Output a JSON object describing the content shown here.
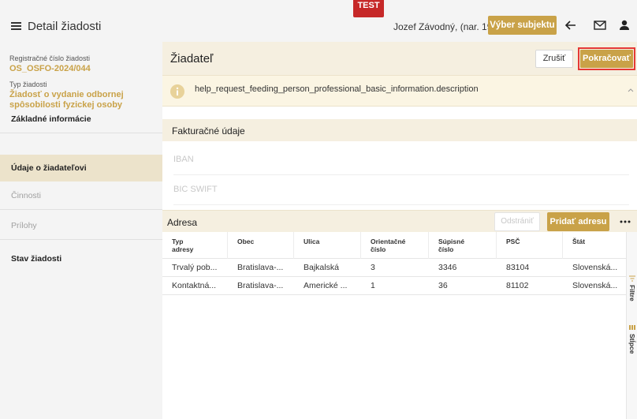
{
  "header": {
    "title": "Detail žiadosti",
    "environment_badge": "TEST",
    "user": "Jozef Závodný, (nar. 1981)",
    "select_subject_label": "Výber subjektu"
  },
  "sidebar": {
    "reg_label": "Registračné číslo žiadosti",
    "reg_value": "OS_OSFO-2024/044",
    "type_label": "Typ žiadosti",
    "type_value_line1": "Žiadosť o vydanie odbornej",
    "type_value_line2": "spôsobilosti fyzickej osoby",
    "nav": [
      {
        "label": "Základné informácie",
        "state": "normal"
      },
      {
        "label": "Údaje o žiadateľovi",
        "state": "active"
      },
      {
        "label": "Činnosti",
        "state": "disabled"
      },
      {
        "label": "Prílohy",
        "state": "disabled"
      },
      {
        "label": "Stav žiadosti",
        "state": "normal"
      }
    ]
  },
  "main": {
    "title": "Žiadateľ",
    "cancel_label": "Zrušiť",
    "continue_label": "Pokračovať",
    "info_text": "help_request_feeding_person_professional_basic_information.description",
    "billing_section": "Fakturačné údaje",
    "iban_placeholder": "IBAN",
    "bic_placeholder": "BIC SWIFT",
    "address": {
      "title": "Adresa",
      "remove_label": "Odstrániť",
      "add_label": "Pridať adresu",
      "columns": [
        [
          "Typ",
          "adresy"
        ],
        [
          "Obec",
          ""
        ],
        [
          "Ulica",
          ""
        ],
        [
          "Orientačné",
          "číslo"
        ],
        [
          "Súpisné",
          "číslo"
        ],
        [
          "PSČ",
          ""
        ],
        [
          "Štát",
          ""
        ]
      ],
      "rows": [
        [
          "Trvalý pob...",
          "Bratislava-...",
          "Bajkalská",
          "3",
          "3346",
          "83104",
          "Slovenská..."
        ],
        [
          "Kontaktná...",
          "Bratislava-...",
          "Americké ...",
          "1",
          "36",
          "81102",
          "Slovenská..."
        ]
      ]
    },
    "side_tools": {
      "filters": "Filtre",
      "columns": "Stĺpce"
    }
  },
  "colors": {
    "accent": "#c9a248",
    "active_nav": "#ece3cb",
    "highlight_border": "#e53935",
    "badge": "#c62828"
  }
}
